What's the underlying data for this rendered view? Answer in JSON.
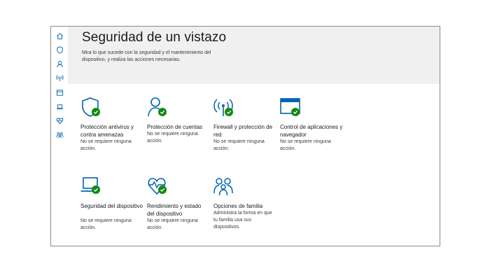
{
  "header": {
    "title": "Seguridad de un vistazo",
    "subtitle": "Mira lo que sucede con la seguridad y el mantenimiento del dispositivo, y realiza las acciones necesarias."
  },
  "sidebar": {
    "items": [
      {
        "icon": "home-icon"
      },
      {
        "icon": "shield-icon"
      },
      {
        "icon": "person-icon"
      },
      {
        "icon": "wifi-antenna-icon"
      },
      {
        "icon": "browser-window-icon"
      },
      {
        "icon": "laptop-icon"
      },
      {
        "icon": "heart-icon"
      },
      {
        "icon": "family-icon"
      }
    ]
  },
  "tiles": [
    {
      "title": "Protección antivirus y contra amenazas",
      "status": "No se requiere ninguna acción.",
      "icon": "shield-icon"
    },
    {
      "title": "Protección de cuentas",
      "status": "No se requiere ninguna acción.",
      "icon": "person-icon"
    },
    {
      "title": "Firewall y protección de red",
      "status": "No se requiere ninguna acción.",
      "icon": "wifi-antenna-icon"
    },
    {
      "title": "Control de aplicaciones y navegador",
      "status": "No se requiere ninguna acción.",
      "icon": "browser-window-icon"
    },
    {
      "title": "Seguridad del dispositivo",
      "status": "No se requiere ninguna acción.",
      "icon": "laptop-icon"
    },
    {
      "title": "Rendimiento y estado del dispositivo",
      "status": "No se requiere ninguna acción.",
      "icon": "heart-pulse-icon"
    },
    {
      "title": "Opciones de familia",
      "status": "Administra la forma en que tu familia usa sus dispositivos.",
      "icon": "family-icon"
    }
  ],
  "colors": {
    "accent": "#0063b1",
    "check": "#138a13",
    "header_bg": "#f0f0f0"
  }
}
